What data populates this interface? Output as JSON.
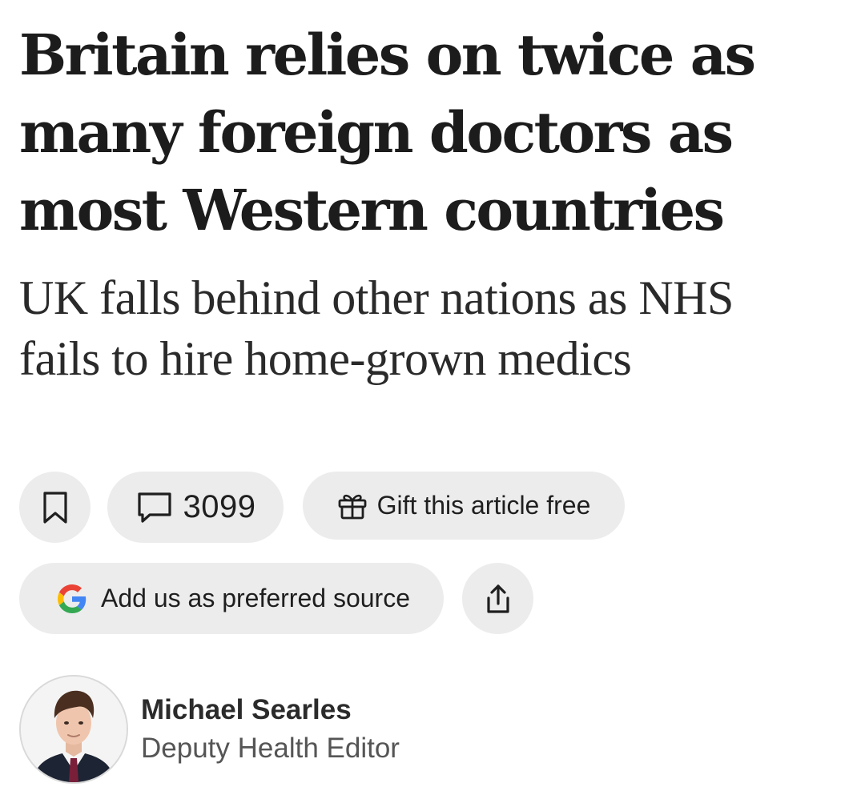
{
  "article": {
    "headline": "Britain relies on twice as many foreign doctors as most Western countries",
    "standfirst": "UK falls behind other nations as NHS fails to hire home-grown medics"
  },
  "actions": {
    "bookmark_icon": "bookmark-icon",
    "comments": {
      "icon": "comment-icon",
      "count": "3099"
    },
    "gift": {
      "icon": "gift-icon",
      "label": "Gift this article free"
    },
    "preferred_source": {
      "icon": "google-icon",
      "label": "Add us as preferred source"
    },
    "share_icon": "share-icon"
  },
  "author": {
    "name": "Michael Searles",
    "role": "Deputy Health Editor"
  },
  "colors": {
    "pill_background": "#ececec",
    "text": "#1a1a1a",
    "secondary_text": "#555555",
    "google_blue": "#4285F4",
    "google_red": "#EA4335",
    "google_yellow": "#FBBC05",
    "google_green": "#34A853"
  }
}
